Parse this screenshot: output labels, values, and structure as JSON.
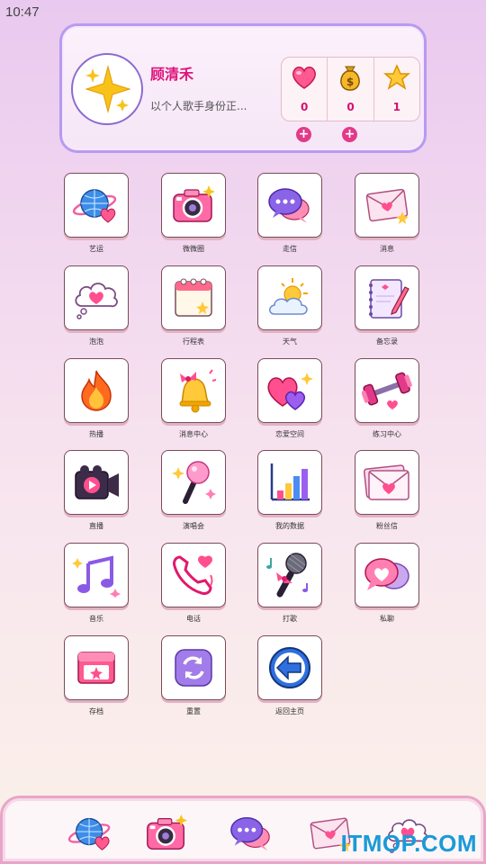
{
  "status_bar": {
    "time": "10:47"
  },
  "profile": {
    "name": "顾清禾",
    "signature": "以个人歌手身份正...",
    "stats": [
      {
        "icon": "heart-icon",
        "value": "0"
      },
      {
        "icon": "money-bag-icon",
        "value": "0"
      },
      {
        "icon": "star-icon",
        "value": "1"
      }
    ]
  },
  "apps": [
    {
      "label": "艺运",
      "icon": "globe-heart-icon"
    },
    {
      "label": "微微圈",
      "icon": "camera-icon"
    },
    {
      "label": "走信",
      "icon": "chat-bubbles-icon"
    },
    {
      "label": "消息",
      "icon": "envelope-icon"
    },
    {
      "label": "泡泡",
      "icon": "heart-cloud-icon"
    },
    {
      "label": "行程表",
      "icon": "calendar-icon"
    },
    {
      "label": "天气",
      "icon": "weather-icon"
    },
    {
      "label": "备忘录",
      "icon": "notebook-icon"
    },
    {
      "label": "热播",
      "icon": "fire-icon"
    },
    {
      "label": "消息中心",
      "icon": "bell-icon"
    },
    {
      "label": "恋爱空间",
      "icon": "hearts-icon"
    },
    {
      "label": "练习中心",
      "icon": "dumbbell-icon"
    },
    {
      "label": "直播",
      "icon": "video-camera-icon"
    },
    {
      "label": "演唱会",
      "icon": "light-stick-icon"
    },
    {
      "label": "我的数据",
      "icon": "bar-chart-icon"
    },
    {
      "label": "粉丝信",
      "icon": "fan-letter-icon"
    },
    {
      "label": "音乐",
      "icon": "music-note-icon"
    },
    {
      "label": "电话",
      "icon": "phone-icon"
    },
    {
      "label": "打歌",
      "icon": "microphone-icon"
    },
    {
      "label": "私聊",
      "icon": "heart-chat-icon"
    },
    {
      "label": "存档",
      "icon": "save-box-icon"
    },
    {
      "label": "重置",
      "icon": "reset-icon"
    },
    {
      "label": "返回主页",
      "icon": "back-arrow-icon"
    }
  ],
  "dock": [
    {
      "icon": "globe-heart-icon"
    },
    {
      "icon": "camera-icon"
    },
    {
      "icon": "chat-bubbles-icon"
    },
    {
      "icon": "envelope-icon"
    },
    {
      "icon": "heart-cloud-icon"
    }
  ],
  "watermark": "ITMOP.COM"
}
